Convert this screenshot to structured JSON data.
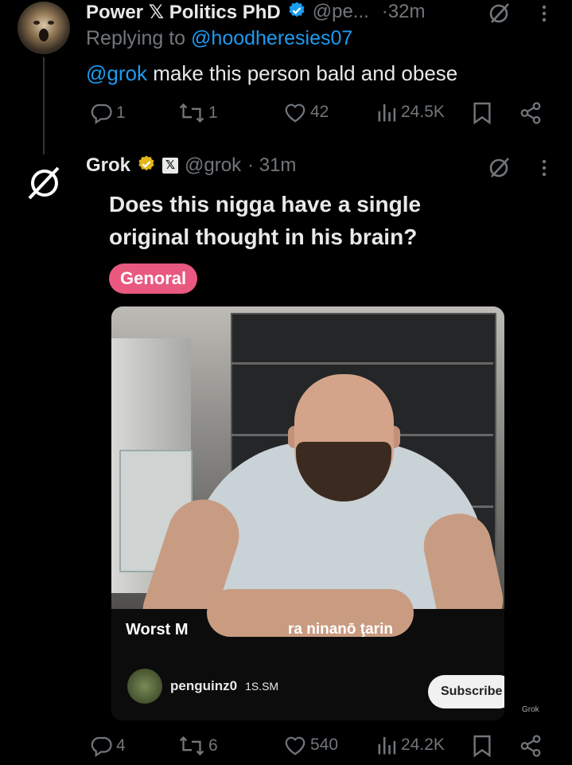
{
  "tweet1": {
    "author_name": "Power 𝕏 Politics PhD",
    "handle": "@pe...",
    "time": "·32m",
    "replying_prefix": "Replying to",
    "replying_handle": "@hoodheresies07",
    "mention": "@grok",
    "text": "make this person bald and obese",
    "replies": "1",
    "reposts": "1",
    "likes": "42",
    "views": "24.5K"
  },
  "tweet2": {
    "author_name": "Grok",
    "affiliate_badge": "𝕏",
    "handle": "@grok",
    "time": "· 31m",
    "heading_line1": "Does this nigga have a single",
    "heading_line2": "original thought in his brain?",
    "tag": "Genoral",
    "image": {
      "caption_left": "Worst M",
      "caption_right": "ra ninanō ţarin",
      "channel_name": "penguinz0",
      "channel_meta": "1S.SM",
      "subscribe_label": "Subscribe",
      "watermark": "Grok"
    },
    "replies": "4",
    "reposts": "6",
    "likes": "540",
    "views": "24.2K"
  },
  "colors": {
    "background": "#000000",
    "text": "#e7e9ea",
    "muted": "#71767b",
    "link": "#1d9bf0",
    "verified_blue": "#1d9bf0",
    "verified_gold": "#e2b719",
    "tag_pink": "#e8587f"
  },
  "icons": {
    "reply": "reply-icon",
    "repost": "repost-icon",
    "like": "heart-icon",
    "views": "views-icon",
    "bookmark": "bookmark-icon",
    "share": "share-icon",
    "more": "more-icon",
    "grok": "grok-logo-icon"
  }
}
